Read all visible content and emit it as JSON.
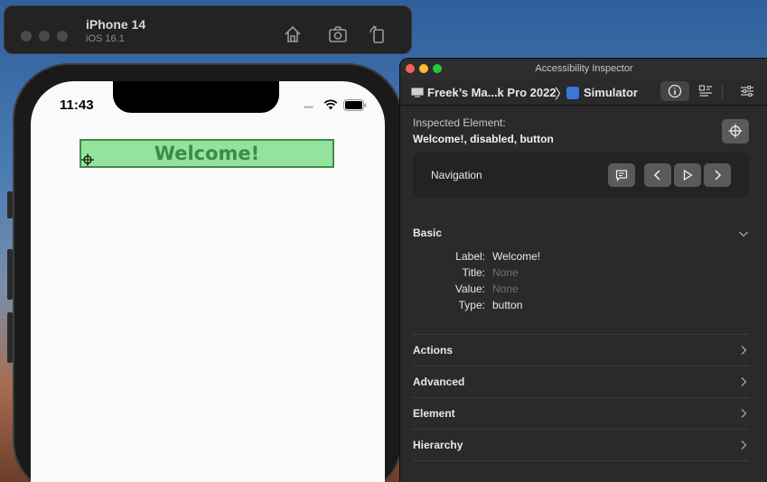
{
  "simulator": {
    "device_name": "iPhone 14",
    "os_version": "iOS 16.1"
  },
  "phone": {
    "status_time": "11:43",
    "status_dots": "••••",
    "welcome_button_label": "Welcome!"
  },
  "inspector": {
    "window_title": "Accessibility Inspector",
    "target_host": "Freek’s Ma...k Pro 2022",
    "target_separator": "〉",
    "target_app": "Simulator",
    "inspected_caption": "Inspected Element:",
    "inspected_value": "Welcome!, disabled, button",
    "navigation_label": "Navigation",
    "basic": {
      "title": "Basic",
      "label_key": "Label:",
      "label_val": "Welcome!",
      "title_key": "Title:",
      "title_val": "None",
      "value_key": "Value:",
      "value_val": "None",
      "type_key": "Type:",
      "type_val": "button"
    },
    "sections": [
      "Actions",
      "Advanced",
      "Element",
      "Hierarchy"
    ],
    "colors": {
      "close": "#fe5f57",
      "minimize": "#febc2e",
      "zoom": "#28c840",
      "button_fill": "#93e39c",
      "button_text": "#3c8a46"
    }
  }
}
